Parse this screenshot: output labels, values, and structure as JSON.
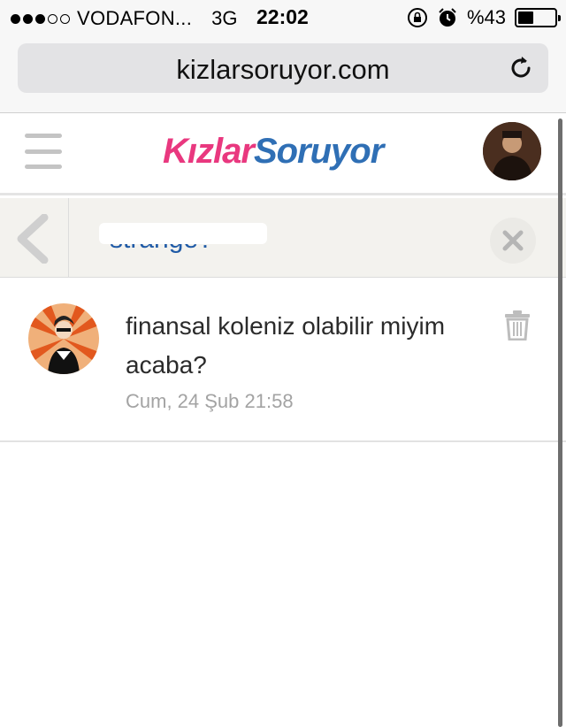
{
  "status_bar": {
    "signal_filled": 3,
    "signal_total": 5,
    "carrier": "VODAFON...",
    "network": "3G",
    "time": "22:02",
    "battery_percent": "%43",
    "battery_level": 0.43,
    "icons": [
      "orientation-lock-icon",
      "alarm-icon",
      "battery-icon"
    ]
  },
  "browser": {
    "url": "kizlarsoruyor.com",
    "reload_icon": "reload-icon"
  },
  "site": {
    "logo_part1": "Kızlar",
    "logo_part2": "Soruyor",
    "logo_colors": {
      "pink": "#e9387f",
      "blue": "#2f6fb5"
    },
    "menu_icon": "hamburger-icon",
    "avatar_icon": "user-avatar"
  },
  "conversation": {
    "title_partial": "strange?",
    "back_icon": "chevron-left-icon",
    "close_icon": "close-icon"
  },
  "messages": [
    {
      "text": "finansal koleniz olabilir miyim acaba?",
      "timestamp": "Cum, 24 Şub 21:58",
      "delete_icon": "trash-icon"
    }
  ],
  "colors": {
    "accent_blue": "#1f5aa6",
    "muted_gray": "#a3a3a3",
    "bar_bg": "#f3f2ee"
  }
}
